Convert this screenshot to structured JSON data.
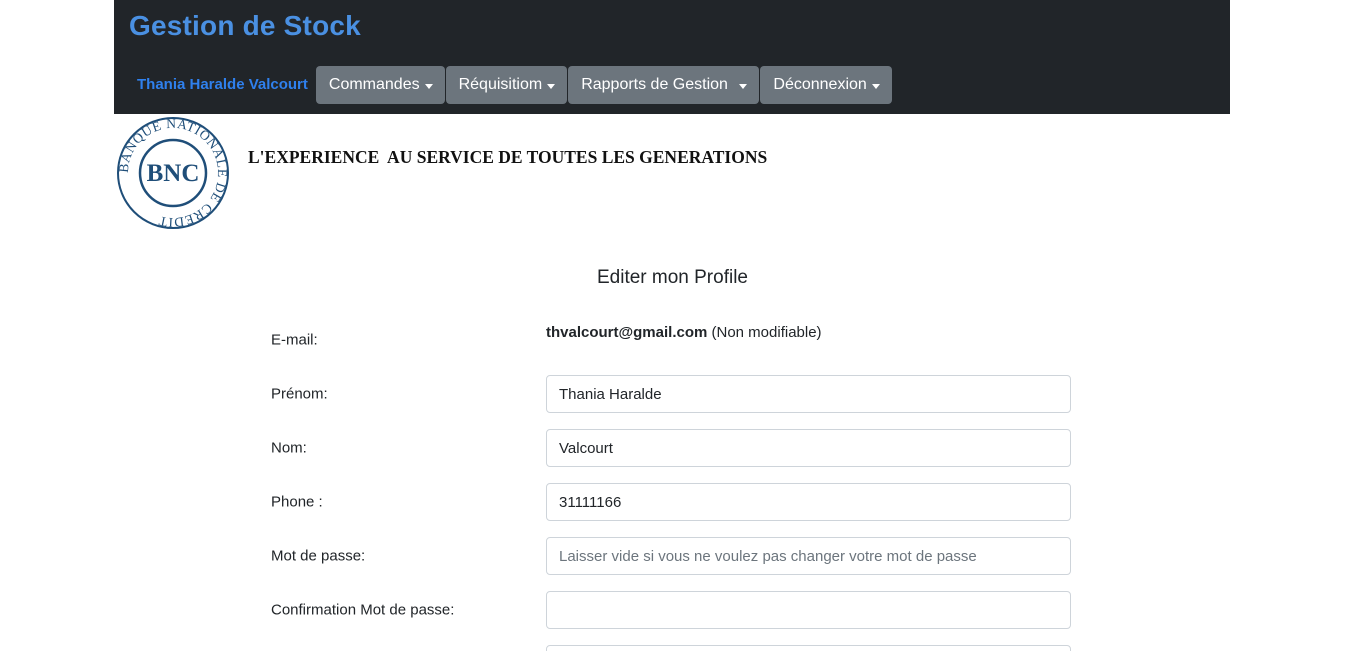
{
  "header": {
    "brand": "Gestion de Stock",
    "user_name": "Thania Haralde Valcourt",
    "menus": [
      {
        "label": "Commandes"
      },
      {
        "label": "Réquisitiom"
      },
      {
        "label": "Rapports de Gestion "
      },
      {
        "label": "Déconnexion"
      }
    ]
  },
  "logo": {
    "ring_text": "BANQUE NATIONALE DE CREDIT",
    "monogram": "BNC",
    "color": "#1f4e79"
  },
  "slogan": "L'EXPERIENCE  AU SERVICE DE TOUTES LES GENERATIONS",
  "form": {
    "title": "Editer mon Profile",
    "email": {
      "label": "E-mail:",
      "value": "thvalcourt@gmail.com",
      "note": " (Non modifiable)"
    },
    "first_name": {
      "label": "Prénom:",
      "value": "Thania Haralde"
    },
    "last_name": {
      "label": "Nom:",
      "value": "Valcourt"
    },
    "phone": {
      "label": "Phone :",
      "value": "31111166"
    },
    "password": {
      "label": "Mot de passe:",
      "value": "",
      "placeholder": "Laisser vide si vous ne voulez pas changer votre mot de passe"
    },
    "password_confirm": {
      "label": "Confirmation Mot de passe:",
      "value": ""
    }
  },
  "colors": {
    "header_bg": "#212529",
    "brand": "#4a90e2",
    "user_link": "#2f80ed",
    "nav_button": "#6c757d"
  }
}
